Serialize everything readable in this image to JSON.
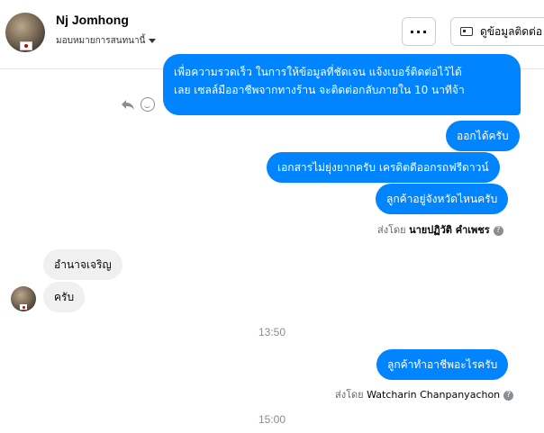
{
  "header": {
    "contact_name": "Nj Jomhong",
    "assignment_label": "มอบหมายการสนทนานี้",
    "more_label": "···",
    "contact_info_label": "ดูข้อมูลติดต่อ"
  },
  "messages": {
    "m1_line1": "เพื่อความรวดเร็ว ในการให้ข้อมูลที่ชัดเจน แจ้งเบอร์ติดต่อไว้ได้",
    "m1_line2": "เลย เซลล์มืออาชีพจากทางร้าน จะติดต่อกลับภายใน 10 นาทีจ้า",
    "m2": "ออกได้ครับ",
    "m3": "เอกสารไม่ยุ่งยากครับ เครดิตดีออกรถฟรีดาวน์",
    "m4": "ลูกค้าอยู่จังหวัดไหนครับ",
    "sent_by_1_prefix": "ส่งโดย",
    "sent_by_1_name": "นายปฏิวัติ คำเพชร",
    "in1": "อำนาจเจริญ",
    "in2": "ครับ",
    "time1": "13:50",
    "m5": "ลูกค้าทำอาชีพอะไรครับ",
    "sent_by_2_prefix": "ส่งโดย",
    "sent_by_2_name": "Watcharin Chanpanyachon",
    "time2": "15:00",
    "info_symbol": "?"
  },
  "colors": {
    "outgoing_bubble": "#0084ff",
    "incoming_bubble": "#f0f0f0"
  },
  "icons": [
    "reply-icon",
    "smile-icon",
    "chevron-down-icon",
    "contact-card-icon",
    "info-icon"
  ]
}
